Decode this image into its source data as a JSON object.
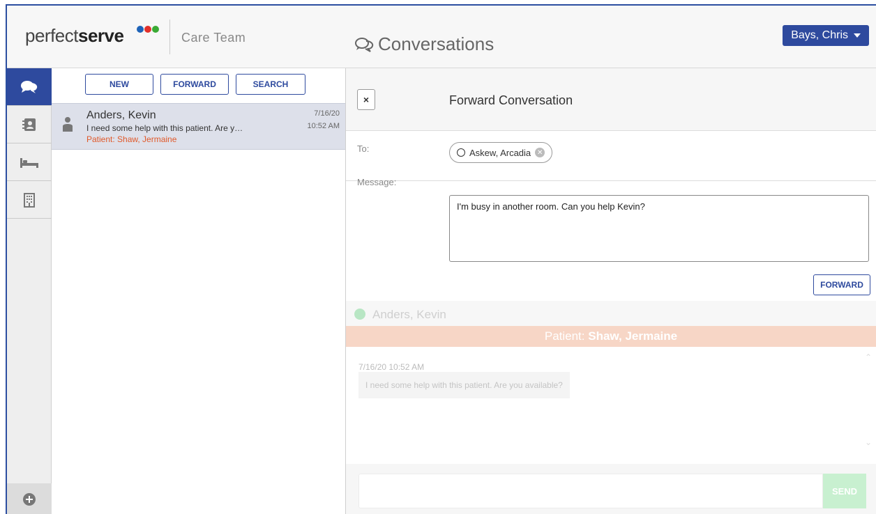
{
  "header": {
    "logo_text_light": "perfect",
    "logo_text_bold": "serve",
    "logo_dot_colors": [
      "#1e63b8",
      "#e2302a",
      "#3aaa35"
    ],
    "app_name": "Care Team",
    "page_title": "Conversations",
    "user_name": "Bays, Chris"
  },
  "nav": {
    "items": [
      {
        "icon": "chat-bubbles-icon",
        "active": true
      },
      {
        "icon": "contact-book-icon",
        "active": false
      },
      {
        "icon": "bed-icon",
        "active": false
      },
      {
        "icon": "building-icon",
        "active": false
      }
    ],
    "add_icon": "plus-circle-icon"
  },
  "list": {
    "actions": [
      "NEW",
      "FORWARD",
      "SEARCH"
    ],
    "conversations": [
      {
        "name": "Anders, Kevin",
        "preview": "I need some help with this patient. Are y…",
        "patient": "Patient: Shaw, Jermaine",
        "date": "7/16/20",
        "time": "10:52 AM"
      }
    ]
  },
  "forward": {
    "close_label": "×",
    "title": "Forward Conversation",
    "to_label": "To:",
    "recipient": "Askew, Arcadia",
    "message_label": "Message:",
    "message_value": "I'm busy in another room. Can you help Kevin?",
    "forward_button": "FORWARD"
  },
  "conversation": {
    "sender": "Anders, Kevin",
    "patient_prefix": "Patient:",
    "patient_name": "Shaw, Jermaine",
    "message_time": "7/16/20 10:52 AM",
    "message_text": "I need some help with this patient. Are you available?",
    "send_label": "SEND"
  },
  "colors": {
    "brand_blue": "#2e4a9e",
    "patient_orange": "#e0592a",
    "online_green": "#b8e6c4"
  }
}
